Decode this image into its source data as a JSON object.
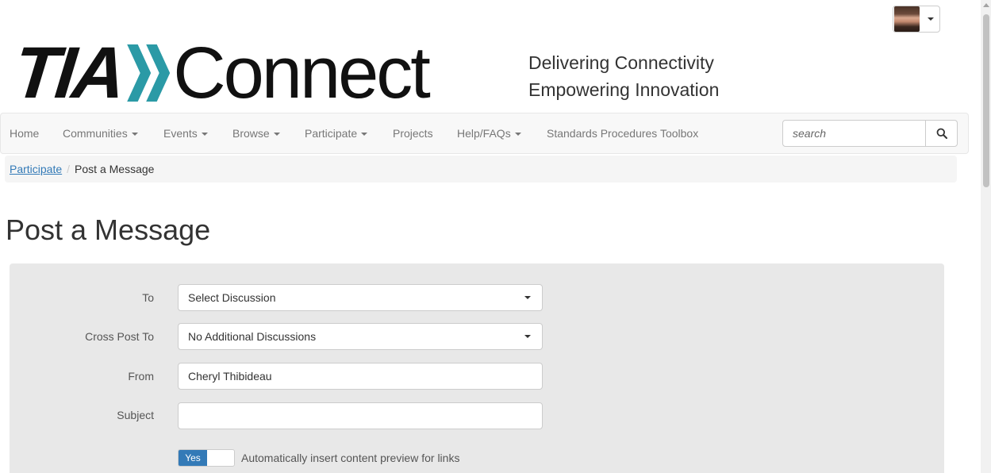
{
  "header": {
    "logo_text": "TIA Connect",
    "tagline_line1": "Delivering Connectivity",
    "tagline_line2": "Empowering Innovation"
  },
  "nav": {
    "items": [
      {
        "label": "Home",
        "dropdown": false
      },
      {
        "label": "Communities",
        "dropdown": true
      },
      {
        "label": "Events",
        "dropdown": true
      },
      {
        "label": "Browse",
        "dropdown": true
      },
      {
        "label": "Participate",
        "dropdown": true
      },
      {
        "label": "Projects",
        "dropdown": false
      },
      {
        "label": "Help/FAQs",
        "dropdown": true
      },
      {
        "label": "Standards Procedures Toolbox",
        "dropdown": false
      }
    ],
    "search_placeholder": "search"
  },
  "breadcrumb": {
    "parent": "Participate",
    "separator": "/",
    "current": "Post a Message"
  },
  "page": {
    "title": "Post a Message"
  },
  "form": {
    "to_label": "To",
    "to_value": "Select Discussion",
    "cross_post_label": "Cross Post To",
    "cross_post_value": "No Additional Discussions",
    "from_label": "From",
    "from_value": "Cheryl Thibideau",
    "subject_label": "Subject",
    "subject_value": "",
    "toggle_state": "Yes",
    "toggle_label": "Automatically insert content preview for links"
  },
  "colors": {
    "accent": "#337ab7",
    "logo_chevron": "#2b9aa6",
    "panel": "#e8e8e8"
  }
}
